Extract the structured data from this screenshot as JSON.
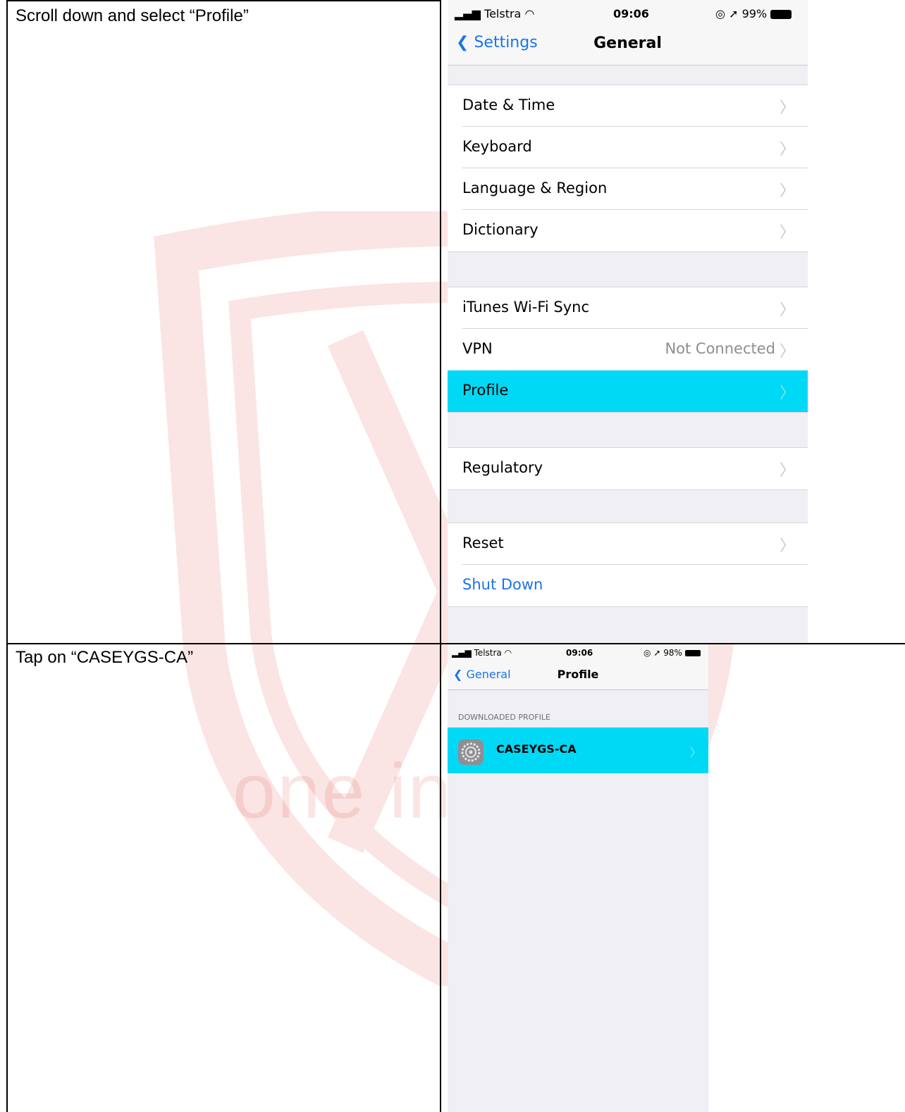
{
  "watermark": {
    "text": "one in t"
  },
  "rows": [
    {
      "instruction": "Scroll down and select “Profile”"
    },
    {
      "instruction": "Tap on “CASEYGS-CA”"
    }
  ],
  "screen1": {
    "status": {
      "carrier": "Telstra",
      "time": "09:06",
      "battery": "99%"
    },
    "nav": {
      "back_label": "Settings",
      "title": "General"
    },
    "groups": [
      [
        {
          "label": "Date & Time"
        },
        {
          "label": "Keyboard"
        },
        {
          "label": "Language & Region"
        },
        {
          "label": "Dictionary"
        }
      ],
      [
        {
          "label": "iTunes Wi-Fi Sync"
        },
        {
          "label": "VPN",
          "value": "Not Connected"
        },
        {
          "label": "Profile",
          "highlighted": true
        }
      ],
      [
        {
          "label": "Regulatory"
        }
      ],
      [
        {
          "label": "Reset"
        },
        {
          "label": "Shut Down"
        }
      ]
    ],
    "highlight_color": "#00d9f5",
    "link_color": "#1a73e8"
  },
  "screen2": {
    "status": {
      "carrier": "Telstra",
      "time": "09:06",
      "battery": "98%"
    },
    "nav": {
      "back_label": "General",
      "title": "Profile"
    },
    "section_header": "DOWNLOADED PROFILE",
    "profile": {
      "name": "CASEYGS-CA",
      "icon": "settings-gear-icon"
    }
  }
}
